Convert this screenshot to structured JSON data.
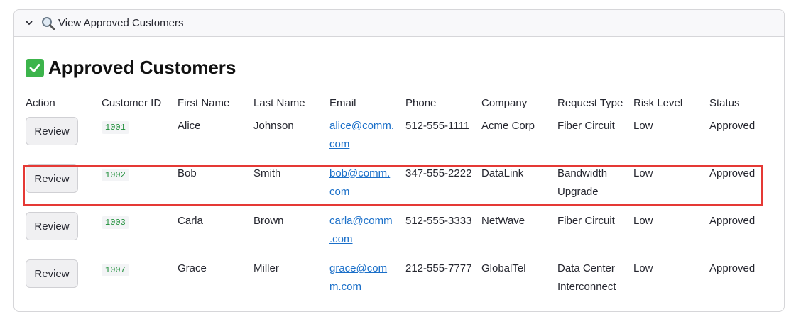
{
  "expander": {
    "title": "View Approved Customers",
    "icon": "magnifier-icon",
    "chevron": "chevron-down-icon"
  },
  "heading": {
    "icon": "check-mark-icon",
    "text": "Approved Customers"
  },
  "table": {
    "columns": [
      "Action",
      "Customer ID",
      "First Name",
      "Last Name",
      "Email",
      "Phone",
      "Company",
      "Request Type",
      "Risk Level",
      "Status"
    ],
    "rows": [
      {
        "action": "Review",
        "id": "1001",
        "first": "Alice",
        "last": "Johnson",
        "email_line1": "alice@comm.",
        "email_line2": "com",
        "phone": "512-555-1111",
        "company": "Acme Corp",
        "request_line1": "Fiber Circuit",
        "request_line2": "",
        "risk": "Low",
        "status": "Approved"
      },
      {
        "action": "Review",
        "id": "1002",
        "first": "Bob",
        "last": "Smith",
        "email_line1": "bob@comm.",
        "email_line2": "com",
        "phone": "347-555-2222",
        "company": "DataLink",
        "request_line1": "Bandwidth",
        "request_line2": "Upgrade",
        "risk": "Low",
        "status": "Approved"
      },
      {
        "action": "Review",
        "id": "1003",
        "first": "Carla",
        "last": "Brown",
        "email_line1": "carla@comm",
        "email_line2": ".com",
        "phone": "512-555-3333",
        "company": "NetWave",
        "request_line1": "Fiber Circuit",
        "request_line2": "",
        "risk": "Low",
        "status": "Approved"
      },
      {
        "action": "Review",
        "id": "1007",
        "first": "Grace",
        "last": "Miller",
        "email_line1": "grace@com",
        "email_line2": "m.com",
        "phone": "212-555-7777",
        "company": "GlobalTel",
        "request_line1": "Data Center",
        "request_line2": "Interconnect",
        "risk": "Low",
        "status": "Approved"
      }
    ]
  },
  "colors": {
    "highlight": "#e53935",
    "link": "#1a6fc9",
    "code": "#1f8f3a",
    "check": "#3cb44b"
  }
}
